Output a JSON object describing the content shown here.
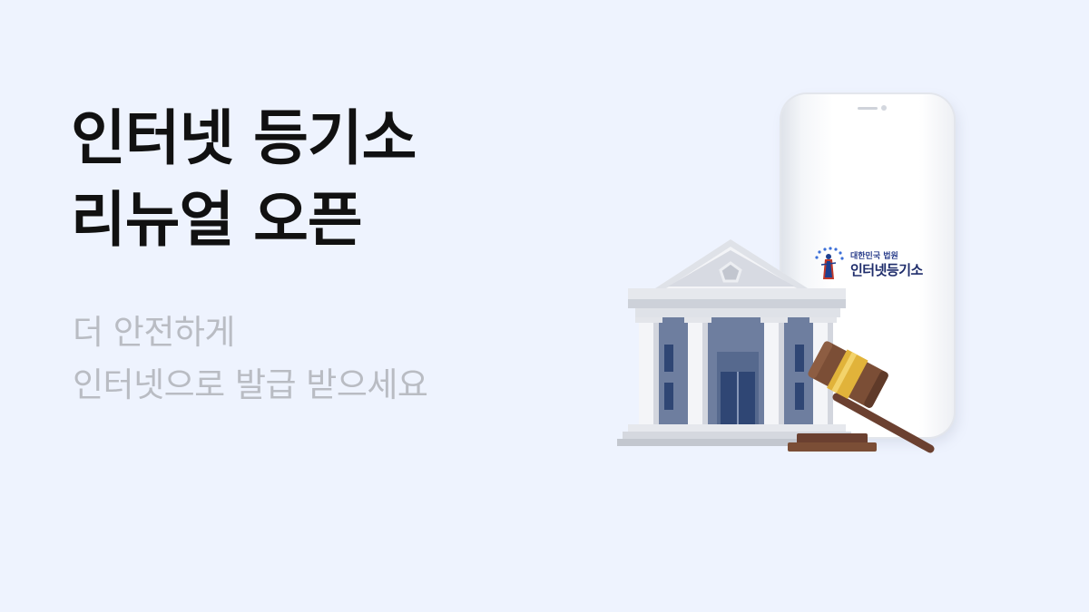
{
  "headline": {
    "line1": "인터넷 등기소",
    "line2": "리뉴얼 오픈"
  },
  "subtext": {
    "line1": "더 안전하게",
    "line2": "인터넷으로 발급 받으세요"
  },
  "phone_app": {
    "court_label": "대한민국 법원",
    "app_name": "인터넷등기소"
  },
  "colors": {
    "background": "#eef3fe",
    "headline": "#111111",
    "subtext": "#b9bcc3",
    "building_stone": "#e9ebf0",
    "building_window": "#6f7e9e",
    "gavel_wood": "#7b4e36",
    "gavel_band": "#e1b33a"
  },
  "icons": [
    "court-building-icon",
    "gavel-icon",
    "court-emblem-icon"
  ]
}
